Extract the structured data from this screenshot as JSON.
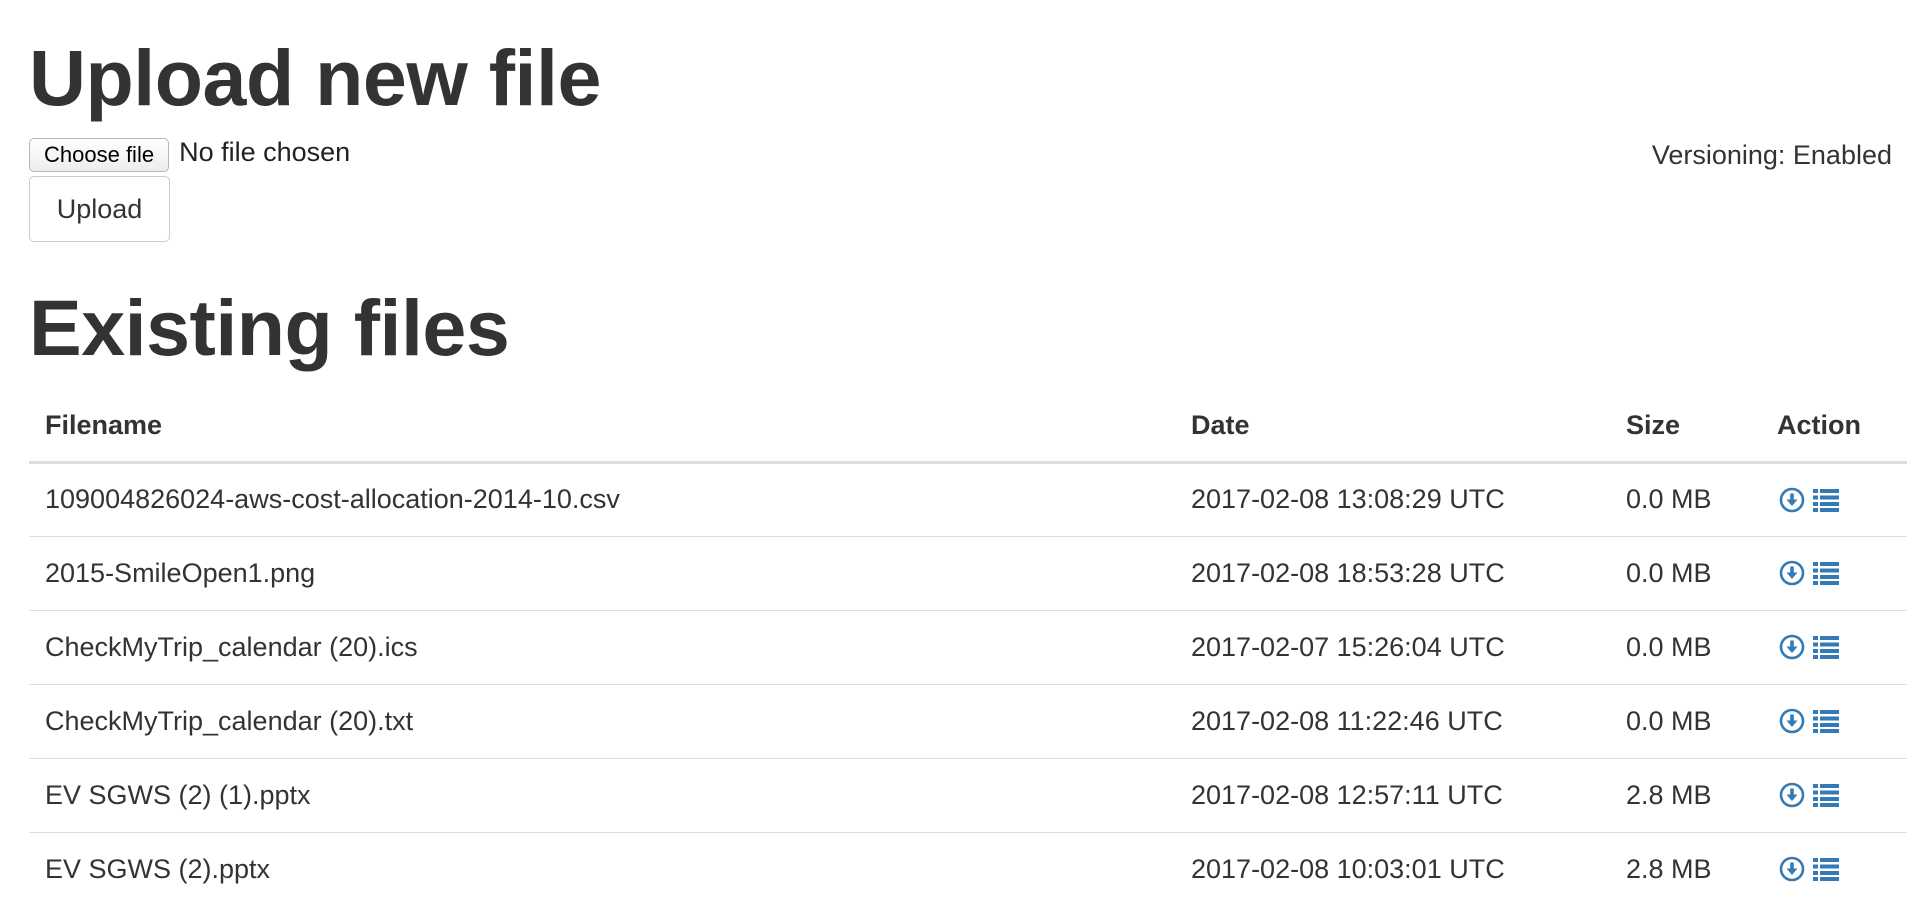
{
  "upload": {
    "title": "Upload new file",
    "choose_file_label": "Choose file",
    "no_file_text": "No file chosen",
    "upload_button_label": "Upload",
    "versioning_text": "Versioning: Enabled"
  },
  "existing": {
    "title": "Existing files",
    "columns": [
      "Filename",
      "Date",
      "Size",
      "Action"
    ],
    "rows": [
      {
        "filename": "109004826024-aws-cost-allocation-2014-10.csv",
        "date": "2017-02-08 13:08:29 UTC",
        "size": "0.0 MB",
        "actions": [
          "download-icon",
          "versions-list-icon"
        ]
      },
      {
        "filename": "2015-SmileOpen1.png",
        "date": "2017-02-08 18:53:28 UTC",
        "size": "0.0 MB",
        "actions": [
          "download-icon",
          "versions-list-icon"
        ]
      },
      {
        "filename": "CheckMyTrip_calendar (20).ics",
        "date": "2017-02-07 15:26:04 UTC",
        "size": "0.0 MB",
        "actions": [
          "download-icon",
          "versions-list-icon"
        ]
      },
      {
        "filename": "CheckMyTrip_calendar (20).txt",
        "date": "2017-02-08 11:22:46 UTC",
        "size": "0.0 MB",
        "actions": [
          "download-icon",
          "versions-list-icon"
        ]
      },
      {
        "filename": "EV SGWS (2) (1).pptx",
        "date": "2017-02-08 12:57:11 UTC",
        "size": "2.8 MB",
        "actions": [
          "download-icon",
          "versions-list-icon"
        ]
      },
      {
        "filename": "EV SGWS (2).pptx",
        "date": "2017-02-08 10:03:01 UTC",
        "size": "2.8 MB",
        "actions": [
          "download-icon",
          "versions-list-icon"
        ]
      }
    ]
  },
  "colors": {
    "text": "#333333",
    "icon": "#337ab7",
    "border": "#dddddd"
  }
}
